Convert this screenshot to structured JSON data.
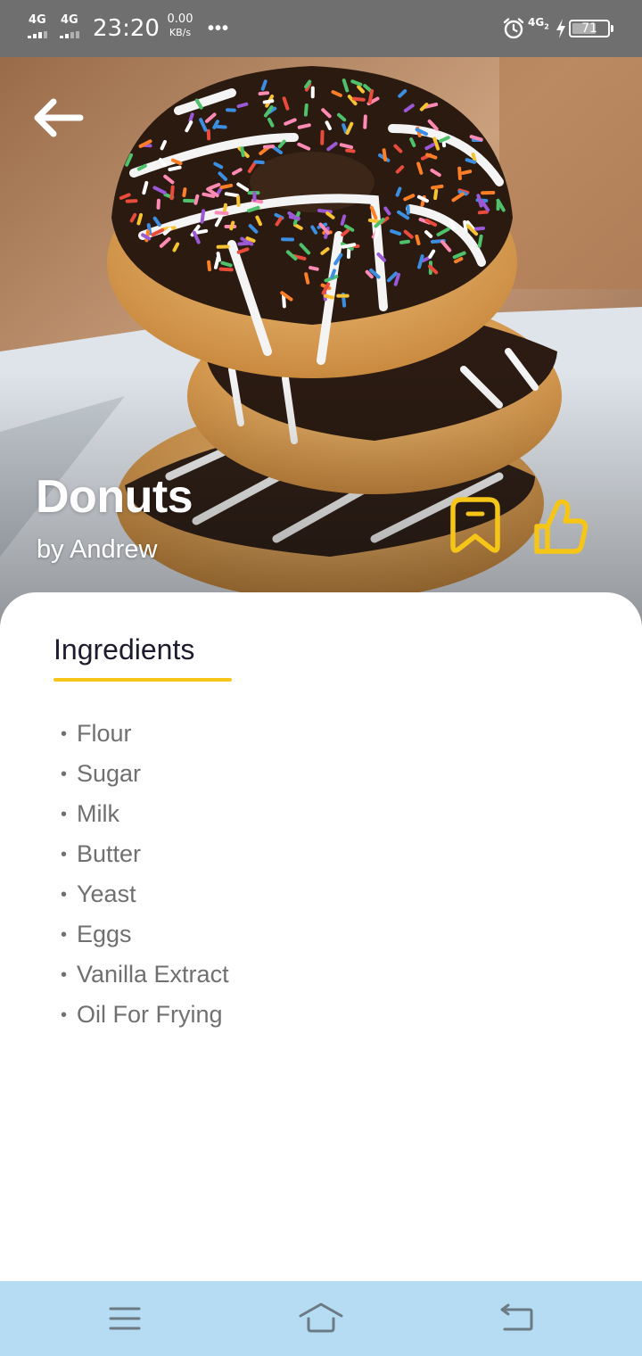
{
  "status_bar": {
    "sim1": "4G",
    "sim2": "4G",
    "time": "23:20",
    "speed_value": "0.00",
    "speed_unit": "KB/s",
    "more_indicator": "•••",
    "network": "4G",
    "network_sub": "2",
    "battery_level": "71",
    "icons": [
      "signal-icon",
      "alarm-icon",
      "charging-icon",
      "battery-icon"
    ]
  },
  "hero": {
    "title": "Donuts",
    "author": "by Andrew",
    "back_icon": "arrow-left-icon",
    "bookmark_icon": "bookmark-icon",
    "like_icon": "thumbs-up-icon"
  },
  "tabs": {
    "active": "Ingredients"
  },
  "ingredients": {
    "bullet": "•",
    "items": [
      "Flour",
      "Sugar",
      "Milk",
      "Butter",
      "Yeast",
      "Eggs",
      "Vanilla Extract",
      "Oil For Frying"
    ]
  },
  "nav_bar": {
    "icons": [
      "menu-icon",
      "home-icon",
      "back-icon"
    ]
  },
  "colors": {
    "accent": "#f5c518",
    "heading": "#1c1c2e",
    "ingredient_text": "#707070",
    "status_bar": "#6f6f6f",
    "nav_bar": "#b5dcf2"
  }
}
